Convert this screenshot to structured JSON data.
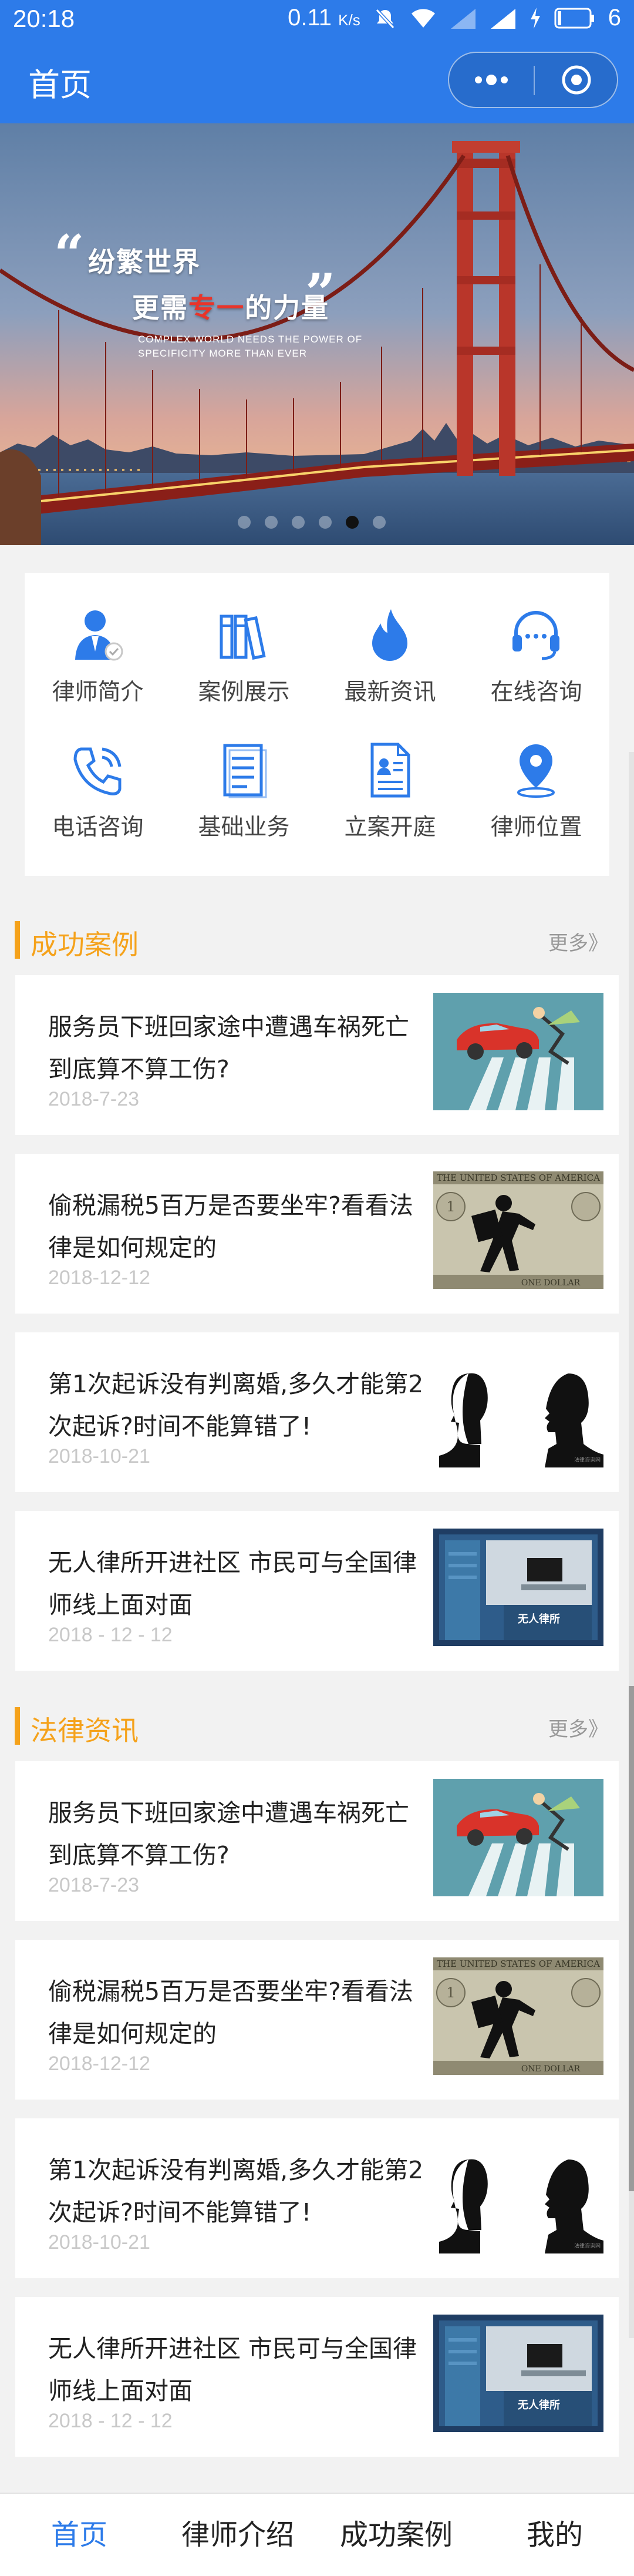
{
  "status_bar": {
    "time": "20:18",
    "speed": "0.11",
    "speed_unit": "K/s",
    "battery": "6"
  },
  "nav": {
    "title": "首页"
  },
  "banner": {
    "slogan_line1": "纷繁世界",
    "slogan_line2_pre": "更需",
    "slogan_line2_highlight": "专一",
    "slogan_line2_post": "的力量",
    "slogan_en_1": "COMPLEX WORLD NEEDS THE POWER OF",
    "slogan_en_2": "SPECIFICITY MORE THAN EVER",
    "slide_count": 6,
    "active_slide": 4
  },
  "menu": [
    {
      "label": "律师简介",
      "icon": "lawyer-profile-icon"
    },
    {
      "label": "案例展示",
      "icon": "case-books-icon"
    },
    {
      "label": "最新资讯",
      "icon": "flame-icon"
    },
    {
      "label": "在线咨询",
      "icon": "headset-icon"
    },
    {
      "label": "电话咨询",
      "icon": "phone-icon"
    },
    {
      "label": "基础业务",
      "icon": "document-icon"
    },
    {
      "label": "立案开庭",
      "icon": "file-case-icon"
    },
    {
      "label": "律师位置",
      "icon": "location-pin-icon"
    }
  ],
  "sections": [
    {
      "title": "成功案例",
      "more": "更多》",
      "items": [
        {
          "title": "服务员下班回家途中遭遇车祸死亡到底算不算工伤?",
          "date": "2018-7-23",
          "thumb": "car-accident"
        },
        {
          "title": "偷税漏税5百万是否要坐牢?看看法律是如何规定的",
          "date": "2018-12-12",
          "thumb": "dollar-thief"
        },
        {
          "title": "第1次起诉没有判离婚,多久才能第2次起诉?时间不能算错了!",
          "date": "2018-10-21",
          "thumb": "couple-silhouette"
        },
        {
          "title": "无人律所开进社区 市民可与全国律师线上面对面",
          "date": "2018 - 12 - 12",
          "thumb": "law-booth"
        }
      ]
    },
    {
      "title": "法律资讯",
      "more": "更多》",
      "items": [
        {
          "title": "服务员下班回家途中遭遇车祸死亡到底算不算工伤?",
          "date": "2018-7-23",
          "thumb": "car-accident"
        },
        {
          "title": "偷税漏税5百万是否要坐牢?看看法律是如何规定的",
          "date": "2018-12-12",
          "thumb": "dollar-thief"
        },
        {
          "title": "第1次起诉没有判离婚,多久才能第2次起诉?时间不能算错了!",
          "date": "2018-10-21",
          "thumb": "couple-silhouette"
        },
        {
          "title": "无人律所开进社区 市民可与全国律师线上面对面",
          "date": "2018 - 12 - 12",
          "thumb": "law-booth"
        }
      ]
    }
  ],
  "tabbar": [
    {
      "label": "首页",
      "active": true
    },
    {
      "label": "律师介绍",
      "active": false
    },
    {
      "label": "成功案例",
      "active": false
    },
    {
      "label": "我的",
      "active": false
    }
  ],
  "colors": {
    "primary": "#2d7be9",
    "accent": "#f5a21b"
  }
}
